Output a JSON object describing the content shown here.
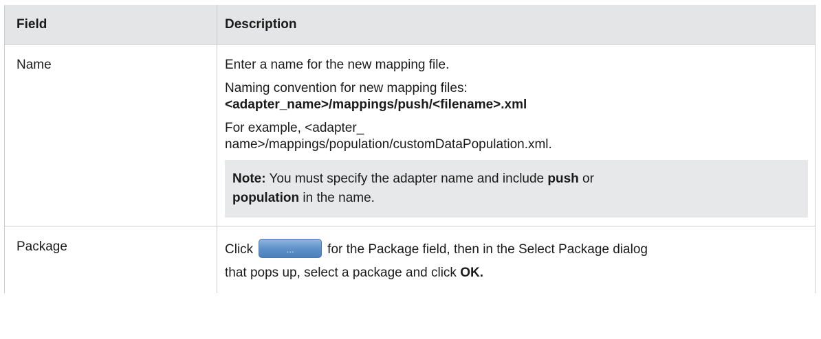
{
  "table": {
    "headers": {
      "field": "Field",
      "description": "Description"
    },
    "rows": {
      "name": {
        "field": "Name",
        "line1": "Enter a name for the new mapping file.",
        "line2a": "Naming convention for new mapping files:",
        "line2b": "<adapter_name>/mappings/push/<filename>.xml",
        "line3a": "For example, <adapter_",
        "line3b": "name>/mappings/population/customDataPopulation.xml.",
        "note": {
          "label": "Note:",
          "t1": " You must specify the adapter name and include ",
          "b1": "push",
          "t2": " or",
          "b2": "population",
          "t3": " in the name."
        }
      },
      "package": {
        "field": "Package",
        "click": "Click",
        "button_label": "...",
        "rest1": "for the Package field, then in the Select Package dialog",
        "rest2": "that pops up, select a package and click ",
        "ok": "OK."
      }
    }
  }
}
